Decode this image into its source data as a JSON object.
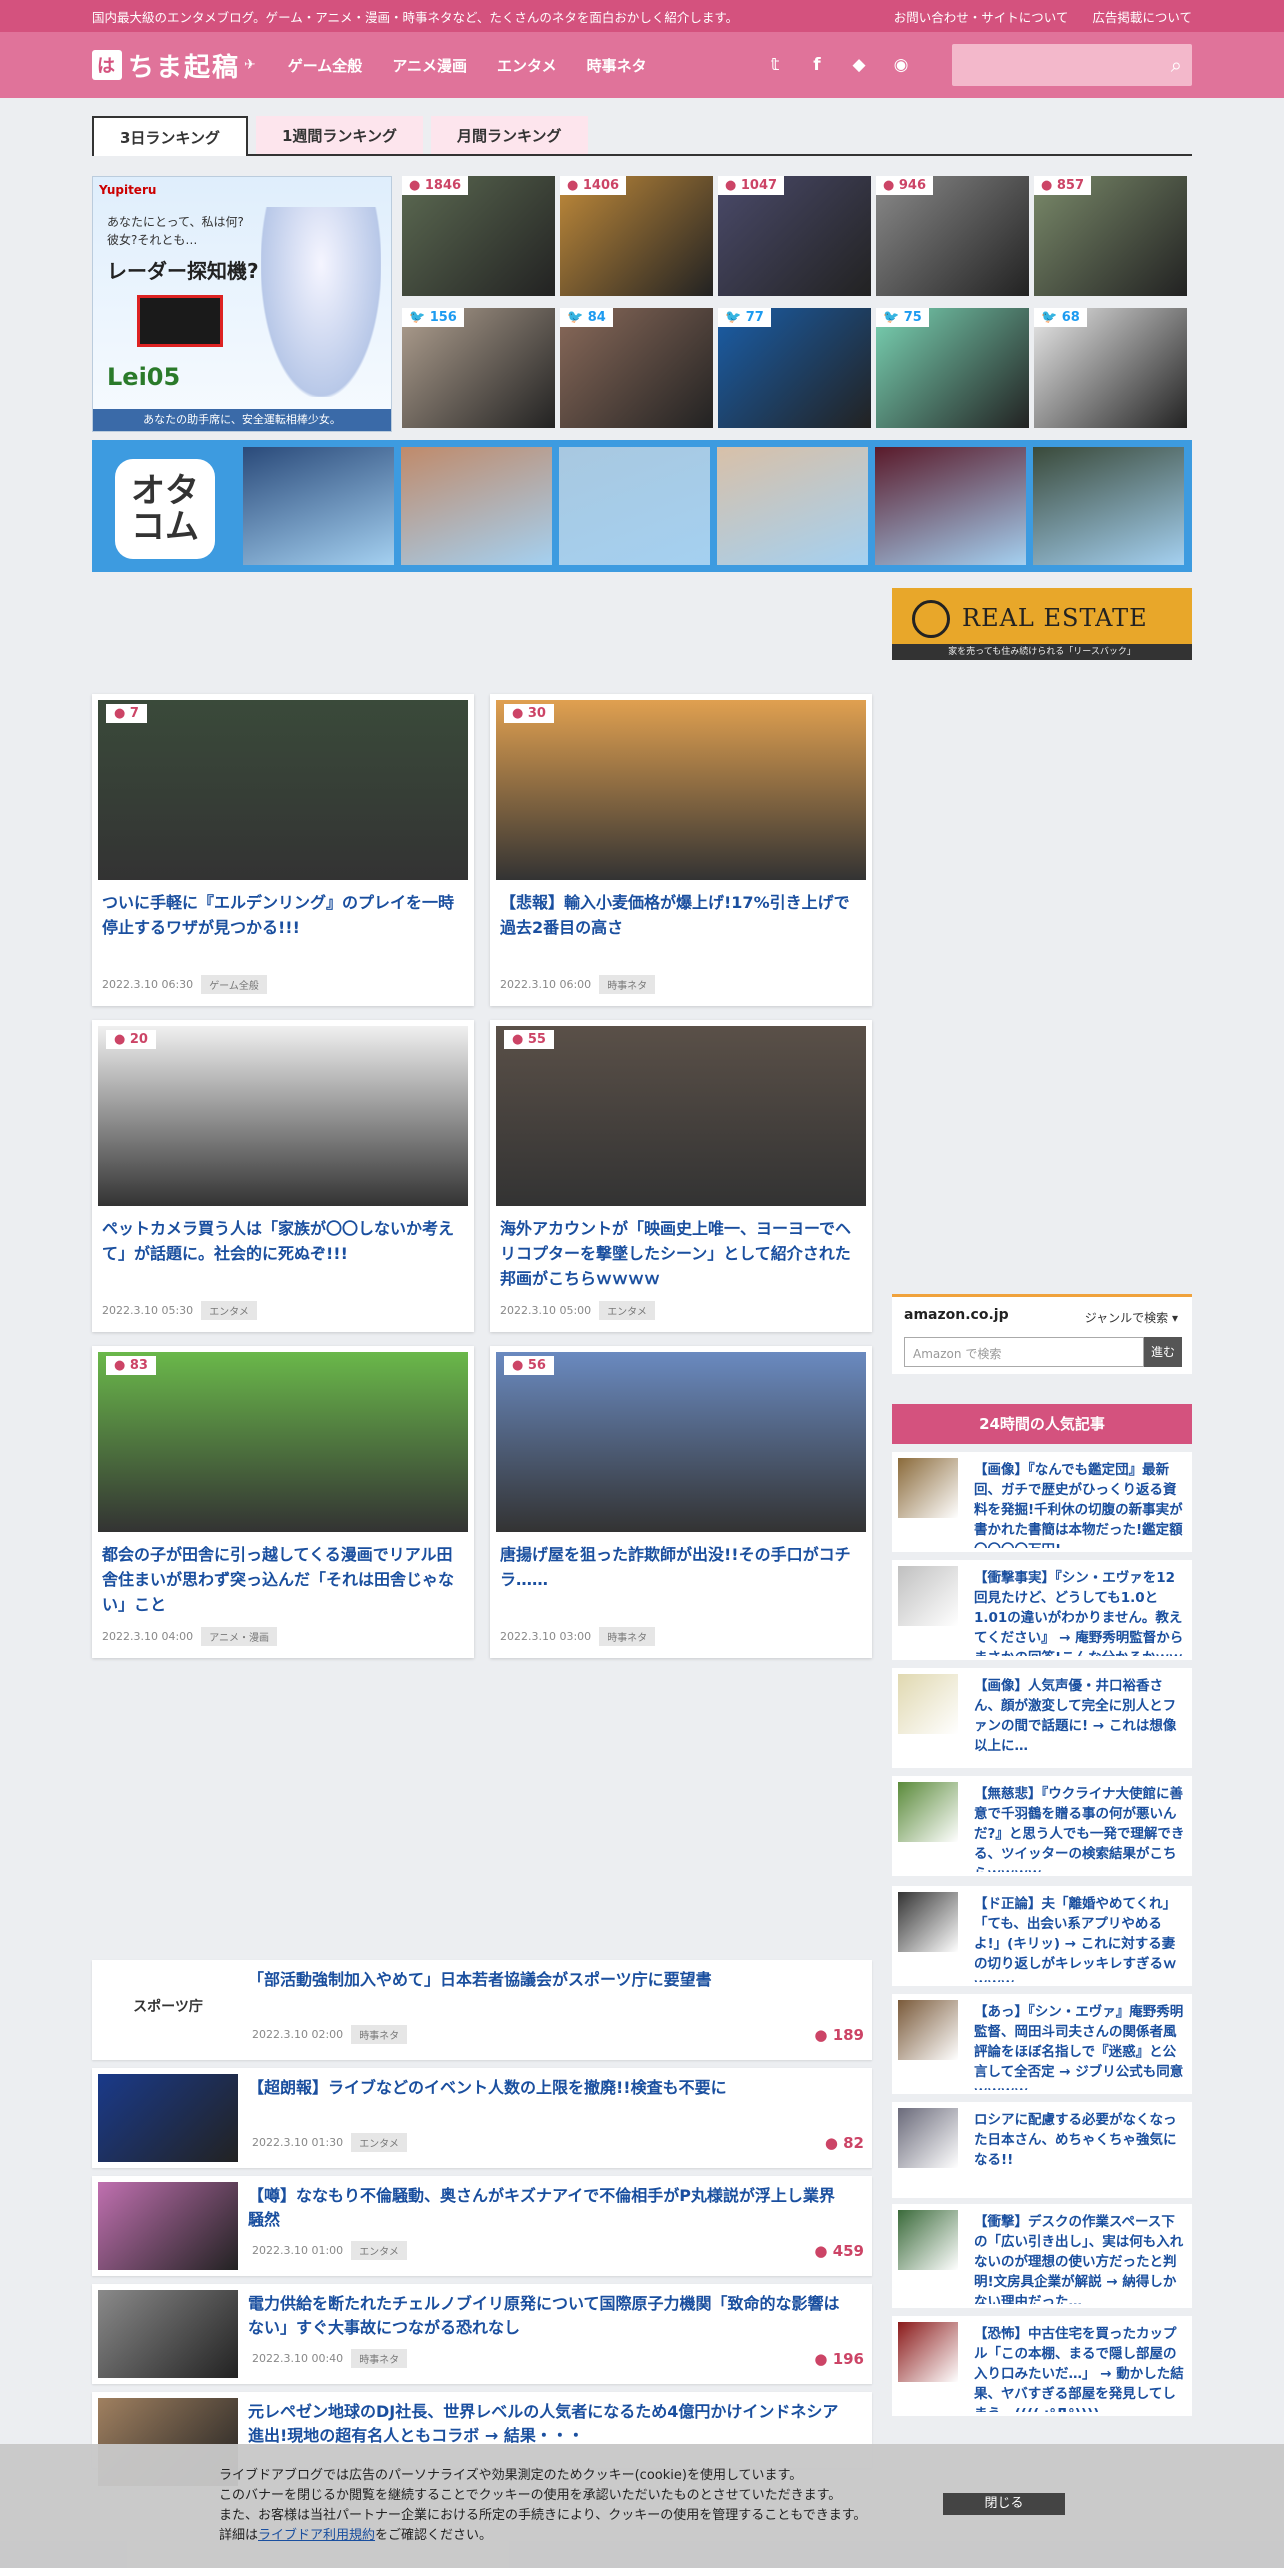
{
  "topbar": {
    "tagline": "国内最大級のエンタメブログ。ゲーム・アニメ・漫画・時事ネタなど、たくさんのネタを面白おかしく紹介します。",
    "links": [
      "お問い合わせ・サイトについて",
      "広告掲載について"
    ]
  },
  "header": {
    "logo_mark": "は",
    "logo_text": "ちま起稿",
    "nav": [
      "ゲーム全般",
      "アニメ漫画",
      "エンタメ",
      "時事ネタ"
    ],
    "social_icons": [
      "twitter-icon",
      "facebook-icon",
      "feedly-icon",
      "rss-icon"
    ]
  },
  "tabs": [
    "3日ランキング",
    "1週間ランキング",
    "月間ランキング"
  ],
  "ranking_ad": {
    "brand": "Yupiteru",
    "question": "あなたにとって、私は何?\n彼女?それとも…",
    "headline": "レーダー探知機?",
    "model": "Lei05",
    "footer": "あなたの助手席に、安全運転相棒少女。"
  },
  "ranking_thumbs": [
    {
      "count": "1846",
      "kind": "comment",
      "color": "#5c6a52"
    },
    {
      "count": "1406",
      "kind": "comment",
      "color": "#c08a3a"
    },
    {
      "count": "1047",
      "kind": "comment",
      "color": "#4a4a6a"
    },
    {
      "count": "946",
      "kind": "comment",
      "color": "#8a8a8a"
    },
    {
      "count": "857",
      "kind": "comment",
      "color": "#7a8a6a"
    },
    {
      "count": "156",
      "kind": "tweet",
      "color": "#b0a090"
    },
    {
      "count": "84",
      "kind": "tweet",
      "color": "#8a6a5a"
    },
    {
      "count": "77",
      "kind": "tweet",
      "color": "#1a5ea8"
    },
    {
      "count": "75",
      "kind": "tweet",
      "color": "#7ad4b4"
    },
    {
      "count": "68",
      "kind": "tweet",
      "color": "#eaeaea"
    }
  ],
  "otaku_banner": {
    "icon_text": "オタ\nコム",
    "images": [
      "#2a4a7a",
      "#c08a6a",
      "#a8c8e0",
      "#d8c0a8",
      "#5a1a2a",
      "#3a4a3a"
    ]
  },
  "real_estate_ad": {
    "text": "REAL ESTATE",
    "sub": "家を売っても住み続けられる「リースバック」"
  },
  "cards": [
    {
      "count": "7",
      "title": "ついに手軽に『エルデンリング』のプレイを一時停止するワザが見つかる!!!",
      "date": "2022.3.10 06:30",
      "tag": "ゲーム全般",
      "color": "#3a4a3a"
    },
    {
      "count": "30",
      "title": "【悲報】輸入小麦価格が爆上げ!17%引き上げで過去2番目の高さ",
      "date": "2022.3.10 06:00",
      "tag": "時事ネタ",
      "color": "#e0a050"
    },
    {
      "count": "20",
      "title": "ペットカメラ買う人は「家族が〇〇しないか考えて」が話題に。社会的に死ぬぞ!!!",
      "date": "2022.3.10 05:30",
      "tag": "エンタメ",
      "color": "#f0f0f0"
    },
    {
      "count": "55",
      "title": "海外アカウントが「映画史上唯一、ヨーヨーでヘリコプターを撃墜したシーン」として紹介された邦画がこちらｗｗｗｗ",
      "date": "2022.3.10 05:00",
      "tag": "エンタメ",
      "color": "#5a5048"
    },
    {
      "count": "83",
      "title": "都会の子が田舎に引っ越してくる漫画でリアル田舎住まいが思わず突っ込んだ「それは田舎じゃない」こと",
      "date": "2022.3.10 04:00",
      "tag": "アニメ・漫画",
      "color": "#6ab84a"
    },
    {
      "count": "56",
      "title": "唐揚げ屋を狙った詐欺師が出没!!その手口がコチラ……",
      "date": "2022.3.10 03:00",
      "tag": "時事ネタ",
      "color": "#6a8ac0"
    }
  ],
  "amazon": {
    "logo": "amazon.co.jp",
    "genre": "ジャンルで検索",
    "placeholder": "Amazon で検索",
    "button": "進む"
  },
  "popular": {
    "heading": "24時間の人気記事",
    "items": [
      {
        "title": "【画像】『なんでも鑑定団』最新回、ガチで歴史がひっくり返る資料を発掘!千利休の切腹の新事実が書かれた書簡は本物だった!鑑定額〇〇〇〇万円!",
        "color": "#8a6a3a"
      },
      {
        "title": "【衝撃事実】『シン・エヴァを12回見たけど、どうしても1.0と1.01の違いがわかりません。教えてください』 → 庵野秀明監督からまさかの回答!こんな分かるかｗｗｗ",
        "color": "#c0c0c0"
      },
      {
        "title": "【画像】人気声優・井口裕香さん、顔が激変して完全に別人とファンの間で話題に! → これは想像以上に…",
        "color": "#e0d8b0"
      },
      {
        "title": "【無慈悲】『ウクライナ大使館に善意で千羽鶴を贈る事の何が悪いんだ?』と思う人でも一発で理解できる、ツイッターの検索結果がこちらｗｗｗｗ",
        "color": "#5a8a3a"
      },
      {
        "title": "【ド正論】夫「離婚やめてくれ」「ても、出会い系アプリやめるよ!」(キリッ) → これに対する妻の切り返しがキレッキレすぎるｗｗｗｗ",
        "color": "#333333"
      },
      {
        "title": "【あっ】『シン・エヴァ』庵野秀明監督、岡田斗司夫さんの関係者風評論をほぼ名指しで『迷惑』と公言して全否定 → ジブリ公式も同意ｗｗｗｗ",
        "color": "#7a5a3a"
      },
      {
        "title": "ロシアに配慮する必要がなくなった日本さん、めちゃくちゃ強気になる!!",
        "color": "#6a6a7a"
      },
      {
        "title": "【衝撃】デスクの作業スペース下の「広い引き出し」、実は何も入れないのが理想の使い方だったと判明!文房具企業が解説 → 納得しかない理由だった…",
        "color": "#3a6a3a"
      },
      {
        "title": "【恐怖】中古住宅を買ったカップル「この本棚、まるで隠し部屋の入り口みたいだ…」 → 動かした結果、ヤバすぎる部屋を発見してしまう…(((( ;°Д°))))",
        "color": "#8a1a1a"
      }
    ]
  },
  "list": [
    {
      "title": "「部活動強制加入やめて」日本若者協議会がスポーツ庁に要望書",
      "date": "2022.3.10 02:00",
      "tag": "時事ネタ",
      "count": "189",
      "image_label": "スポーツ庁",
      "color": "#ffffff"
    },
    {
      "title": "【超朗報】ライブなどのイベント人数の上限を撤廃!!検査も不要に",
      "date": "2022.3.10 01:30",
      "tag": "エンタメ",
      "count": "82",
      "image_label": "",
      "color": "#1a3a8a"
    },
    {
      "title": "【噂】ななもり不倫騒動、奥さんがキズナアイで不倫相手がP丸様説が浮上し業界騒然",
      "date": "2022.3.10 01:00",
      "tag": "エンタメ",
      "count": "459",
      "image_label": "",
      "color": "#c070b0"
    },
    {
      "title": "電力供給を断たれたチェルノブイリ原発について国際原子力機関「致命的な影響はない」すぐ大事故につながる恐れなし",
      "date": "2022.3.10 00:40",
      "tag": "時事ネタ",
      "count": "196",
      "image_label": "",
      "color": "#8a8a8a"
    },
    {
      "title": "元レペゼン地球のDJ社長、世界レベルの人気者になるため4億円かけインドネシア進出!現地の超有名人ともコラボ → 結果・・・",
      "date": "",
      "tag": "",
      "count": "",
      "image_label": "",
      "color": "#a08060"
    }
  ],
  "cookie": {
    "lines": [
      "ライブドアブログでは広告のパーソナライズや効果測定のためクッキー(cookie)を使用しています。",
      "このバナーを閉じるか閲覧を継続することでクッキーの使用を承認いただいたものとさせていただきます。",
      "また、お客様は当社パートナー企業における所定の手続きにより、クッキーの使用を管理することもできます。"
    ],
    "detail_prefix": "詳細は",
    "detail_link": "ライブドア利用規約",
    "detail_suffix": "をご確認ください。",
    "close": "閉じる"
  }
}
